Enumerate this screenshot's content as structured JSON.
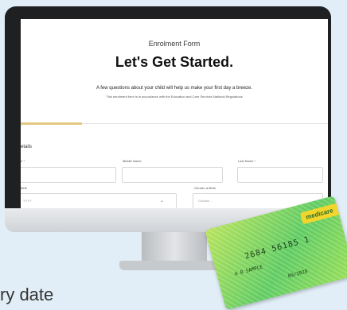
{
  "form": {
    "header_small": "Enrolment Form",
    "title": "Let's Get Started.",
    "subtitle": "A few questions about your child will help us make your first day a breeze.",
    "note": "This enrolment form is in accordance with the Education and Care Services National Regulations",
    "progress_fraction": 0.2,
    "section_label": "etails",
    "fields": {
      "first_name_label": "e *",
      "middle_name_label": "Middle Name",
      "last_name_label": "Last Name *",
      "dob_label": "Birth",
      "dob_value": "YYYY",
      "gender_label": "Gender at Birth",
      "gender_value": "Choose..."
    }
  },
  "card": {
    "brand": "medicare",
    "number": "2684 56185 1",
    "name": "A B SAMPLE",
    "expiry": "09/2028"
  },
  "bottom_text": "ry date",
  "colors": {
    "background": "#e2eef7",
    "monitor_bezel": "#1f2022",
    "progress": "#e5c982",
    "card_green": "#5ecb61",
    "card_brand": "#f2d62b"
  }
}
